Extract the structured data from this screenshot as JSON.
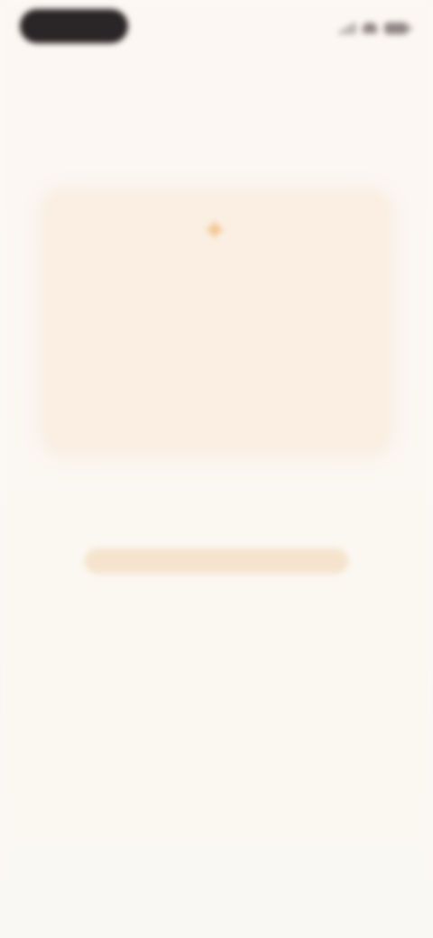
{
  "status_bar": {
    "time": "",
    "icons": [
      "signal-icon",
      "wifi-icon",
      "battery-icon"
    ],
    "pill_color": "#2a2526"
  },
  "card": {
    "icon": "sparkle-icon",
    "message": "",
    "caption": "",
    "background": "#fbefe3",
    "accent": "#f0c48c"
  },
  "actions": {
    "primary_label": "",
    "primary_color": "#f5e3cd",
    "secondary_label": ""
  },
  "colors": {
    "background": "#fbf7f2"
  }
}
